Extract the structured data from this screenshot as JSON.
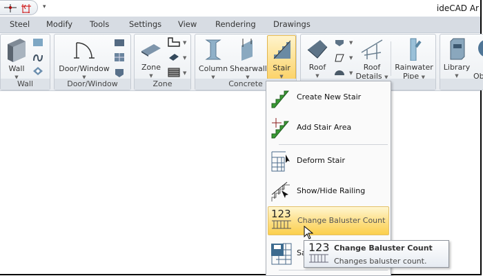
{
  "window": {
    "title": "ideCAD Ar"
  },
  "quick_access": {
    "menu_glyph": "▾",
    "icons": [
      "axis-icon",
      "dimension-icon"
    ]
  },
  "tabs": [
    "Steel",
    "Modify",
    "Tools",
    "Settings",
    "View",
    "Rendering",
    "Drawings"
  ],
  "ribbon": {
    "groups": [
      {
        "label": "Wall",
        "buttons": [
          "Wall"
        ]
      },
      {
        "label": "Door/Window",
        "buttons": [
          "Door/Window"
        ]
      },
      {
        "label": "Zone",
        "buttons": [
          "Zone"
        ]
      },
      {
        "label": "Concrete",
        "buttons": [
          "Column",
          "Shearwall",
          "Stair"
        ]
      },
      {
        "label": "",
        "buttons": [
          "Roof",
          "Roof Details",
          "Rainwater Pipe"
        ]
      },
      {
        "label": "",
        "buttons": [
          "Library",
          "Ob"
        ]
      }
    ],
    "roof_details": [
      "Roof",
      "Details"
    ],
    "rainwater": [
      "Rainwater",
      "Pipe"
    ],
    "active_button": "Stair",
    "accent": "#fcd36a"
  },
  "stair_menu": {
    "items": [
      {
        "label": "Create New Stair",
        "icon": "stair-green-icon"
      },
      {
        "label": "Add Stair Area",
        "icon": "stair-add-icon"
      },
      {
        "label": "Deform Stair",
        "icon": "deform-stair-icon"
      },
      {
        "label": "Show/Hide Railing",
        "icon": "railing-icon"
      },
      {
        "label": "Change Baluster Count",
        "icon": "baluster-count-icon",
        "highlighted": true
      },
      {
        "label": "Sa",
        "icon": "save-grid-icon"
      }
    ]
  },
  "tooltip": {
    "icon_text": "123",
    "title": "Change Baluster Count",
    "description": "Changes baluster count."
  },
  "baluster_icon_text": "123"
}
